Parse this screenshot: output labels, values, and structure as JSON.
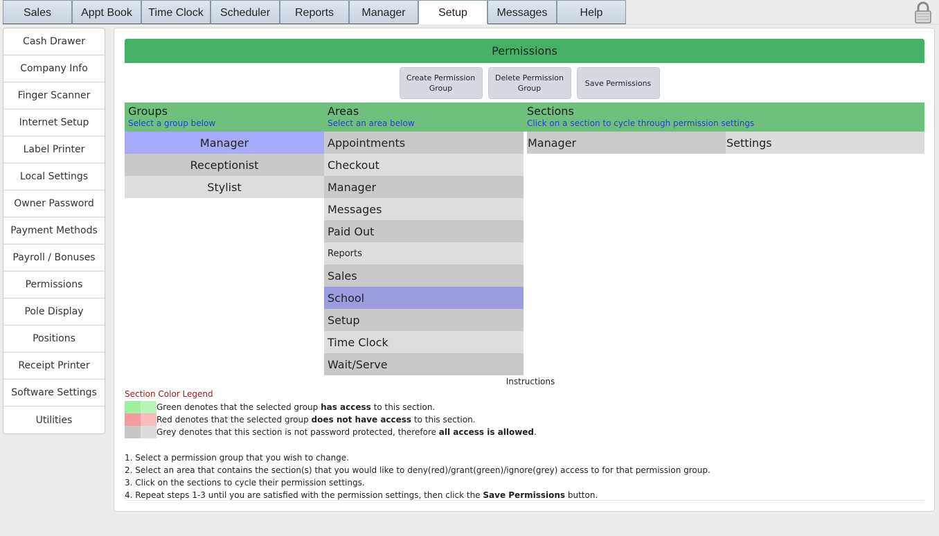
{
  "top_tabs": [
    {
      "label": "Sales"
    },
    {
      "label": "Appt Book"
    },
    {
      "label": "Time Clock"
    },
    {
      "label": "Scheduler"
    },
    {
      "label": "Reports"
    },
    {
      "label": "Manager"
    },
    {
      "label": "Setup",
      "active": true
    },
    {
      "label": "Messages"
    },
    {
      "label": "Help"
    }
  ],
  "sidebar": {
    "items": [
      {
        "label": "Cash Drawer"
      },
      {
        "label": "Company Info"
      },
      {
        "label": "Finger Scanner"
      },
      {
        "label": "Internet Setup"
      },
      {
        "label": "Label Printer"
      },
      {
        "label": "Local Settings"
      },
      {
        "label": "Owner Password"
      },
      {
        "label": "Payment Methods"
      },
      {
        "label": "Payroll / Bonuses"
      },
      {
        "label": "Permissions"
      },
      {
        "label": "Pole Display"
      },
      {
        "label": "Positions"
      },
      {
        "label": "Receipt Printer"
      },
      {
        "label": "Software Settings"
      },
      {
        "label": "Utilities"
      }
    ]
  },
  "main": {
    "title": "Permissions",
    "buttons": {
      "create": "Create Permission Group",
      "delete": "Delete Permission Group",
      "save": "Save Permissions"
    },
    "columns": {
      "groups": {
        "title": "Groups",
        "hint": "Select a group below"
      },
      "areas": {
        "title": "Areas",
        "hint": "Select an area below"
      },
      "sections": {
        "title": "Sections",
        "hint": "Click on a section to cycle through permission settings"
      }
    },
    "groups": [
      {
        "label": "Manager",
        "selected": true
      },
      {
        "label": "Receptionist"
      },
      {
        "label": "Stylist"
      }
    ],
    "areas": [
      {
        "label": "Appointments"
      },
      {
        "label": "Checkout"
      },
      {
        "label": "Manager"
      },
      {
        "label": "Messages"
      },
      {
        "label": "Paid Out"
      },
      {
        "label": "Reports"
      },
      {
        "label": "Sales"
      },
      {
        "label": "School",
        "selected": true
      },
      {
        "label": "Setup"
      },
      {
        "label": "Time Clock"
      },
      {
        "label": "Wait/Serve"
      }
    ],
    "sections": [
      {
        "label": "Manager"
      },
      {
        "label": "Settings"
      }
    ],
    "instructions_label": "Instructions",
    "legend": {
      "title": "Section Color Legend",
      "green": {
        "pre": "Green denotes that the selected group ",
        "bold": "has access",
        "post": " to this section.",
        "colors": [
          "#9ff19f",
          "#b9f5b9"
        ]
      },
      "red": {
        "pre": "Red denotes that the selected group ",
        "bold": "does not have access",
        "post": " to this section.",
        "colors": [
          "#f49b9b",
          "#f7bdbd"
        ]
      },
      "grey": {
        "pre": "Grey denotes that this section is not password protected, therefore ",
        "bold": "all access is allowed",
        "post": ".",
        "colors": [
          "#c8c8c8",
          "#dcdcdc"
        ]
      }
    },
    "steps": {
      "s1": "1. Select a permission group that you wish to change.",
      "s2": "2. Select an area that contains the section(s) that you would like to deny(red)/grant(green)/ignore(grey) access to for that permission group.",
      "s3": "3. Click on the sections to cycle their permission settings.",
      "s4_pre": "4. Repeat steps 1-3 until you are satisfied with the permission settings, then click the ",
      "s4_bold": "Save Permissions",
      "s4_post": " button."
    }
  }
}
